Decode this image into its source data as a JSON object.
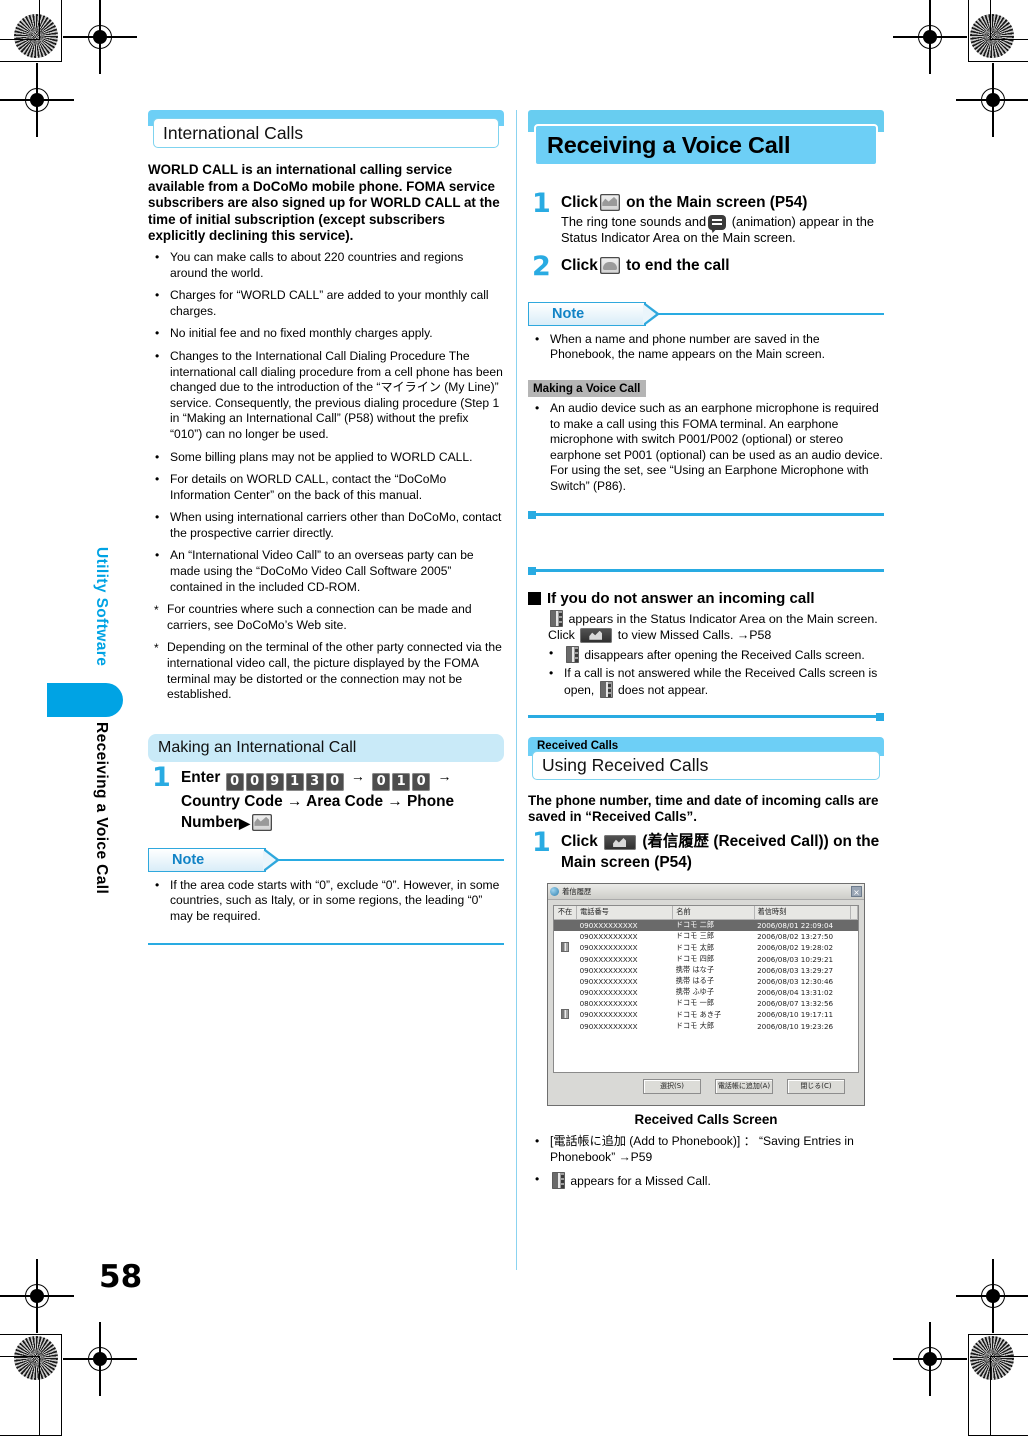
{
  "page": {
    "number": "58",
    "side_label_top": "Utility Software",
    "side_label_bottom": "Receiving a Voice Call"
  },
  "left_column": {
    "section_heading": "International Calls",
    "lead": "WORLD CALL is an international calling service available from a DoCoMo mobile phone. FOMA service subscribers are also signed up for WORLD CALL at the time of initial subscription (except subscribers explicitly declining this service).",
    "bullets": [
      {
        "mark": "•",
        "text": "You can make calls to about 220 countries and regions around the world."
      },
      {
        "mark": "•",
        "text": "Charges for “WORLD CALL” are added to your monthly call charges."
      },
      {
        "mark": "•",
        "text": "No initial fee and no fixed monthly charges apply."
      },
      {
        "mark": "•",
        "text": "Changes to the International Call Dialing Procedure The international call dialing procedure from a cell phone has been changed due to the introduction of the “マイライン (My Line)” service. Consequently, the previous dialing procedure (Step 1 in “Making an International Call” (P58) without the prefix “010”) can no longer be used."
      },
      {
        "mark": "•",
        "text": "Some billing plans may not be applied to WORLD CALL."
      },
      {
        "mark": "•",
        "text": "For details on WORLD CALL, contact the “DoCoMo Information Center” on the back of this manual."
      },
      {
        "mark": "•",
        "text": "When using international carriers other than DoCoMo, contact the prospective carrier directly."
      },
      {
        "mark": "•",
        "text": "An “International Video Call” to an overseas party can be made using the “DoCoMo Video Call Software 2005” contained in the included CD-ROM."
      },
      {
        "mark": "*",
        "text": "For countries where such a connection can be made and carriers, see DoCoMo’s Web site."
      },
      {
        "mark": "*",
        "text": "Depending on the terminal of the other party connected via the international video call, the picture displayed by the FOMA terminal may be distorted or the connection may not be established."
      }
    ],
    "pill_heading": "Making an International Call",
    "step1": {
      "number": "1",
      "prefix": "Enter",
      "keys_group1": [
        "0",
        "0",
        "9",
        "1",
        "3",
        "0"
      ],
      "arrow": "→",
      "keys_group2": [
        "0",
        "1",
        "0"
      ],
      "tail": "Country Code → Area Code → Phone Number"
    },
    "note_label": "Note",
    "note_bullets": [
      {
        "mark": "•",
        "text": "If the area code starts with “0”, exclude “0”. However, in some countries, such as Italy, or in some regions, the leading “0” may be required."
      }
    ]
  },
  "right_column": {
    "chapter_heading": "Receiving a Voice Call",
    "step1": {
      "number": "1",
      "title_before": "Click",
      "title_after": "on the Main screen (P54)",
      "desc_before": "The ring tone sounds and",
      "desc_after": "(animation) appear in the Status Indicator Area on the Main screen."
    },
    "step2": {
      "number": "2",
      "title_before": "Click",
      "title_after": "to end the call"
    },
    "note_label": "Note",
    "note_bullets": [
      {
        "mark": "•",
        "text": "When a name and phone number are saved in the Phonebook, the name appears on the Main screen."
      }
    ],
    "grey_label": "Making a Voice Call",
    "grey_bullets": [
      {
        "mark": "•",
        "text": "An audio device such as an earphone microphone is required to make a call using this FOMA terminal. An earphone microphone with switch P001/P002 (optional) or stereo earphone set P001 (optional) can be used as an audio device. For using the set, see “Using an Earphone Microphone with Switch” (P86)."
      }
    ],
    "square_heading": "If you do not answer an incoming call",
    "square_body_1": "appears in the Status Indicator Area on the Main screen. Click",
    "square_body_2": "to view Missed Calls. →P58",
    "square_bullets": [
      {
        "mark": "•",
        "text_after": "disappears after opening the Received Calls screen."
      },
      {
        "mark": "•",
        "text_before": "If a call is not answered while the Received Calls screen is open,",
        "text_after": "does not appear."
      }
    ],
    "received_calls": {
      "label": "Received Calls",
      "heading": "Using Received Calls",
      "lead": "The phone number, time and date of incoming calls are saved in “Received Calls”.",
      "step1": {
        "number": "1",
        "title_before": "Click",
        "title_after": "(着信履歴 (Received Call)) on the Main screen (P54)"
      },
      "screenshot_caption": "Received Calls Screen",
      "bullets": [
        {
          "mark": "•",
          "text": "[電話帳に追加 (Add to Phonebook)] ： “Saving Entries in Phonebook” →P59"
        },
        {
          "mark": "•",
          "text_after": "appears for a Missed Call."
        }
      ]
    }
  },
  "dialog": {
    "title": "着信履歴",
    "close_label": "×",
    "columns": [
      "不在",
      "電話番号",
      "名前",
      "着信時刻"
    ],
    "rows": [
      {
        "flag": "",
        "number": "090XXXXXXXXX",
        "name": "ドコモ 二郎",
        "date": "2006/08/01 22:09:04",
        "selected": true
      },
      {
        "flag": "",
        "number": "090XXXXXXXXX",
        "name": "ドコモ 三郎",
        "date": "2006/08/02 13:27:50",
        "selected": false
      },
      {
        "flag": "m",
        "number": "090XXXXXXXXX",
        "name": "ドコモ 太郎",
        "date": "2006/08/02 19:28:02",
        "selected": false
      },
      {
        "flag": "",
        "number": "090XXXXXXXXX",
        "name": "ドコモ 四郎",
        "date": "2006/08/03 10:29:21",
        "selected": false
      },
      {
        "flag": "",
        "number": "090XXXXXXXXX",
        "name": "携帯 はな子",
        "date": "2006/08/03 13:29:27",
        "selected": false
      },
      {
        "flag": "",
        "number": "090XXXXXXXXX",
        "name": "携帯 はる子",
        "date": "2006/08/03 12:30:46",
        "selected": false
      },
      {
        "flag": "",
        "number": "090XXXXXXXXX",
        "name": "携帯 ふゆ子",
        "date": "2006/08/04 13:31:02",
        "selected": false
      },
      {
        "flag": "",
        "number": "080XXXXXXXXX",
        "name": "ドコモ 一郎",
        "date": "2006/08/07 13:32:56",
        "selected": false
      },
      {
        "flag": "m",
        "number": "090XXXXXXXXX",
        "name": "ドコモ あき子",
        "date": "2006/08/10 19:17:11",
        "selected": false
      },
      {
        "flag": "",
        "number": "090XXXXXXXXX",
        "name": "ドコモ 大郎",
        "date": "2006/08/10 19:23:26",
        "selected": false
      }
    ],
    "buttons": [
      "選択(S)",
      "電話帳に追加(A)",
      "閉じる(C)"
    ]
  },
  "colors": {
    "accent_cyan": "#29abe2",
    "header_blue": "#6dcff6",
    "pill_blue": "#c9eaf8"
  }
}
